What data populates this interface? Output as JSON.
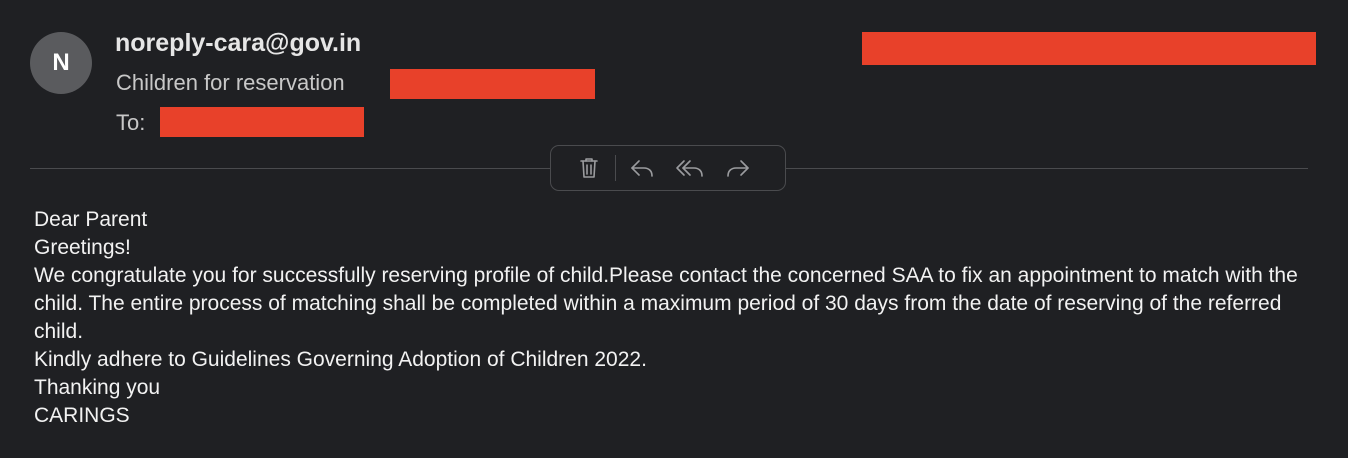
{
  "header": {
    "avatar_initial": "N",
    "sender": "noreply-cara@gov.in",
    "subject": "Children for reservation",
    "to_label": "To:"
  },
  "toolbar": {
    "actions": [
      {
        "name": "delete",
        "icon": "trash-icon"
      },
      {
        "name": "reply",
        "icon": "reply-icon"
      },
      {
        "name": "reply-all",
        "icon": "reply-all-icon"
      },
      {
        "name": "forward",
        "icon": "forward-icon"
      }
    ]
  },
  "message": {
    "greeting": "Dear Parent",
    "line2": "Greetings!",
    "paragraph": "We congratulate you for successfully reserving profile of child.Please contact the concerned SAA to fix an appointment to match with the child. The entire process of matching shall be completed within a maximum period of 30 days from the date of reserving of the referred child.",
    "line4": "Kindly adhere to Guidelines Governing Adoption of Children 2022.",
    "closing": "Thanking you",
    "signature": "CARINGS"
  },
  "colors": {
    "background": "#1f2023",
    "redaction": "#e8412a",
    "avatar": "#5a5b5e"
  }
}
